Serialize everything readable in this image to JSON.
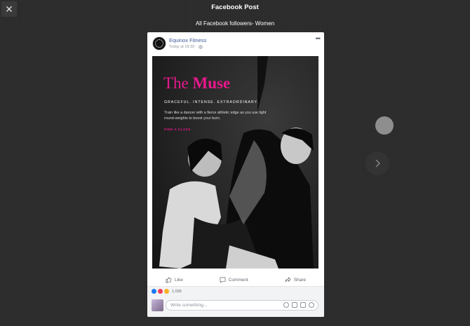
{
  "header": {
    "close_icon": "close-icon",
    "title": "Facebook Post",
    "subtitle": "All Facebook followers- Women"
  },
  "post": {
    "page_name": "Equinox Fitness",
    "timestamp": "Today at 19:33",
    "separator": "·",
    "audience_icon": "globe-icon",
    "more_icon": "more-horizontal-icon",
    "ad": {
      "title_plain": "The ",
      "title_bold": "Muse",
      "tagline": "GRACEFUL. INTENSE. EXTRAORDINARY.",
      "body": "Train like a dancer with a fierce athletic edge as you use light round-weights to boost your burn.",
      "cta": "FIND A CLASS",
      "accent_color": "#e8188c"
    },
    "actions": {
      "like": "Like",
      "comment": "Comment",
      "share": "Share"
    },
    "reactions": {
      "icons": [
        "like-reaction-icon",
        "love-reaction-icon",
        "wow-reaction-icon"
      ],
      "count": "1,035"
    },
    "comment_placeholder": "Write something..."
  },
  "navigation": {
    "next_icon": "chevron-right-icon"
  },
  "colors": {
    "brand_link": "#3b5998",
    "like_blue": "#1877f2"
  }
}
